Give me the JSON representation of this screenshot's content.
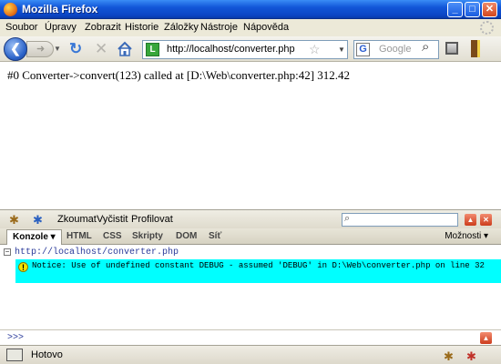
{
  "window": {
    "title": "Mozilla Firefox"
  },
  "menu": [
    "Soubor",
    "Úpravy",
    "Zobrazit",
    "Historie",
    "Záložky",
    "Nástroje",
    "Nápověda"
  ],
  "nav": {
    "url": "http://localhost/converter.php",
    "search_placeholder": "Google",
    "site_icon_letter": "L"
  },
  "page": {
    "text": "#0 Converter->convert(123) called at [D:\\Web\\converter.php:42] 312.42"
  },
  "firebug": {
    "tools": [
      "Zkoumat",
      "Vyčistit",
      "Profilovat"
    ],
    "tabs": [
      {
        "label": "Konzole ▾",
        "active": true
      },
      {
        "label": "HTML"
      },
      {
        "label": "CSS"
      },
      {
        "label": "Skripty"
      },
      {
        "label": "DOM"
      },
      {
        "label": "Síť"
      }
    ],
    "options_label": "Možnosti ▾",
    "console": {
      "source_url": "http://localhost/converter.php",
      "notice": "Notice: Use of undefined constant DEBUG - assumed 'DEBUG' in D:\\Web\\converter.php on line 32",
      "notice_color": "#00ffff",
      "prompt": ">>>"
    }
  },
  "status": {
    "text": "Hotovo"
  },
  "colors": {
    "titlebar": "#1256d8",
    "chrome": "#ece9d8"
  }
}
